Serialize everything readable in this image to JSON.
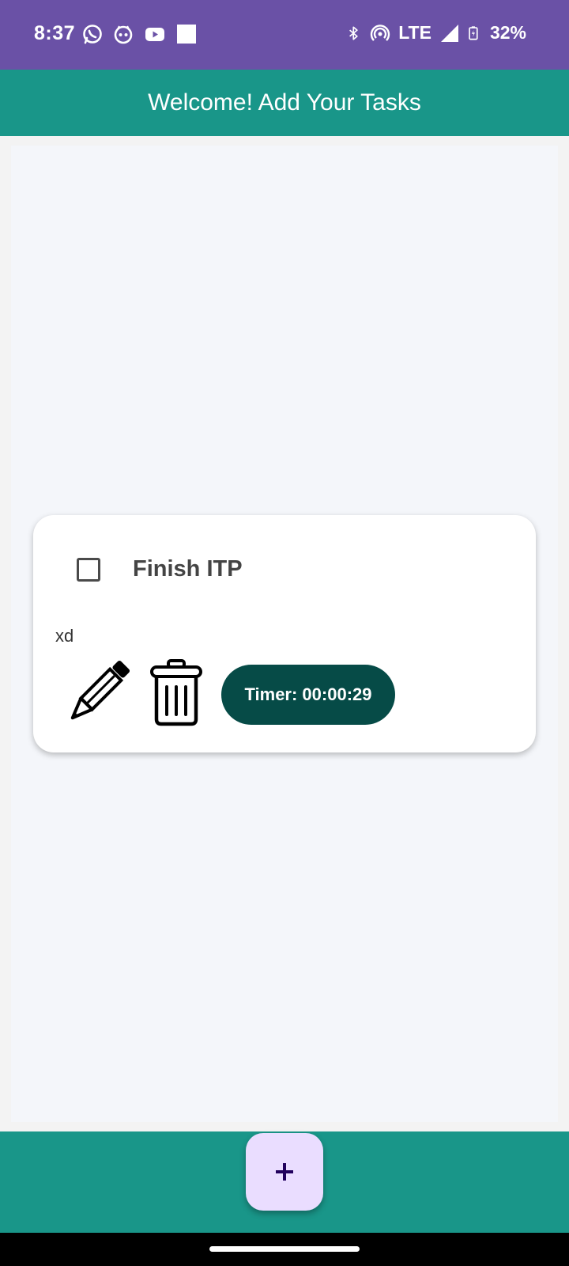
{
  "status_bar": {
    "time": "8:37",
    "left_icons": [
      "whatsapp-icon",
      "notification-icon",
      "youtube-icon",
      "square-icon"
    ],
    "network": "LTE",
    "battery": "32%",
    "background": "#6a51a6"
  },
  "app_bar": {
    "title": "Welcome! Add Your Tasks",
    "background": "#199689"
  },
  "task": {
    "title": "Finish ITP",
    "description": "xd",
    "checked": false,
    "timer_label": "Timer: 00:00:29",
    "timer_color": "#064b47",
    "edit_icon": "pencil-icon",
    "delete_icon": "trash-icon"
  },
  "fab": {
    "icon": "plus-icon",
    "background": "#eaddff",
    "icon_color": "#21005d"
  }
}
